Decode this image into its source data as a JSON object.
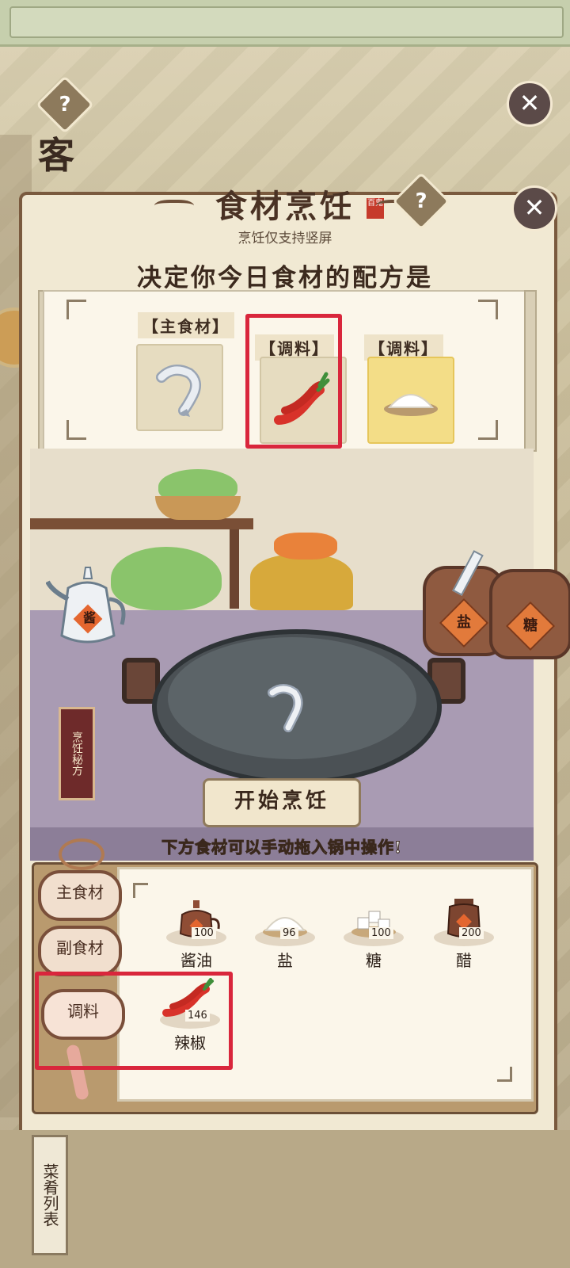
{
  "header": {
    "title": "食材烹饪",
    "seal": "百鬼",
    "subtitle": "烹饪仅支持竖屏",
    "recipe_heading": "决定你今日食材的配方是"
  },
  "background": {
    "side_char": "客"
  },
  "recipe_slots": [
    {
      "label": "【主食材】",
      "content": "shrimp-icon",
      "highlighted": false
    },
    {
      "label": "【调料】",
      "content": "chili-pepper-icon",
      "highlighted": true
    },
    {
      "label": "【调料】",
      "content": "salt-icon",
      "highlighted": false
    }
  ],
  "kitchen": {
    "secret_recipe_tag": "烹饪秘方",
    "jar_labels": [
      "盐",
      "糖"
    ],
    "teapot_label": "酱",
    "wok_content": "shrimp-icon",
    "start_button": "开始烹饪",
    "drag_hint": "下方食材可以手动拖入锅中操作!"
  },
  "tray": {
    "tabs": [
      {
        "label": "主食材",
        "active": false
      },
      {
        "label": "副食材",
        "active": false
      },
      {
        "label": "调料",
        "active": true
      }
    ],
    "ingredients": [
      {
        "name": "酱油",
        "count": "100",
        "icon": "soy-sauce-pot-icon"
      },
      {
        "name": "盐",
        "count": "96",
        "icon": "salt-icon"
      },
      {
        "name": "糖",
        "count": "100",
        "icon": "sugar-cubes-icon"
      },
      {
        "name": "醋",
        "count": "200",
        "icon": "vinegar-jar-icon"
      },
      {
        "name": "辣椒",
        "count": "146",
        "icon": "chili-pepper-icon"
      }
    ]
  },
  "footer": {
    "menu_list": "菜肴列表"
  },
  "colors": {
    "highlight": "#d9263c",
    "panel": "#f1e9d3",
    "wood": "#7a5a3e"
  }
}
